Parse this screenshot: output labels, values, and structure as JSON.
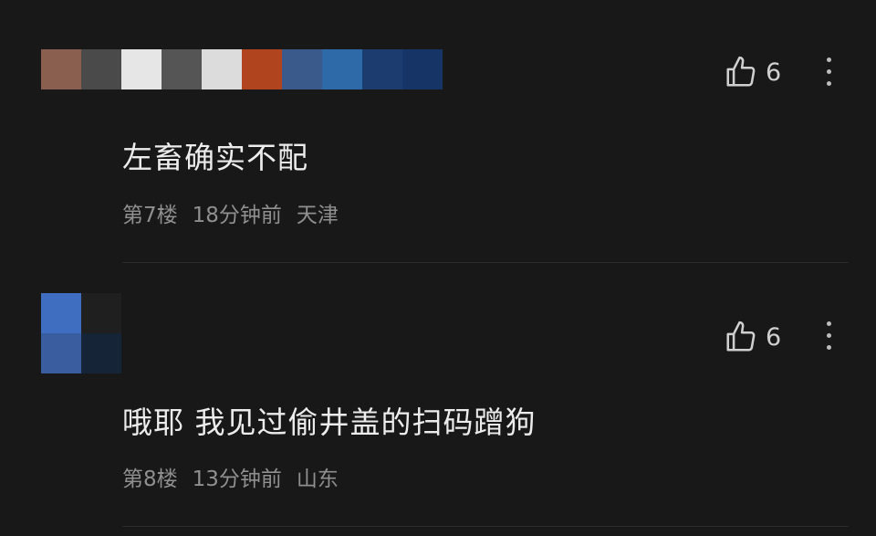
{
  "comments": [
    {
      "floor": "第7楼",
      "time": "18分钟前",
      "location": "天津",
      "text": "左畜确实不配",
      "likes": "6",
      "avatar_colors": [
        "#8a5f4f",
        "#4a4a4a",
        "#e6e6e6",
        "#555555",
        "#dcdcdc",
        "#b0441e",
        "#3a5a8c",
        "#2f6aa8",
        "#1c3b6e",
        "#173467",
        "#1c1c1c"
      ]
    },
    {
      "floor": "第8楼",
      "time": "13分钟前",
      "location": "山东",
      "text": "哦耶 我见过偷井盖的扫码蹭狗",
      "likes": "6",
      "avatar_colors": [
        "#3f6dc0",
        "#1f1f1f",
        "#1b1b1b",
        "#1d1d1d",
        "#1c1c1c",
        "#1a1a1a",
        "#1b1b1b",
        "#1d1d1d",
        "#3a5da0",
        "#162437",
        "#1b1b1b"
      ]
    }
  ],
  "icons": {
    "like": "thumbs-up-outline-icon",
    "more": "vertical-ellipsis-icon"
  }
}
